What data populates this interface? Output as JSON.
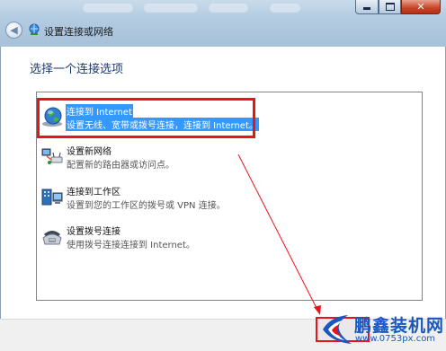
{
  "window": {
    "title": "设置连接或网络",
    "back_icon": "back-arrow-icon",
    "controls": {
      "minimize_icon": "minimize-icon",
      "maximize_icon": "maximize-icon",
      "close_icon": "close-icon",
      "close_glyph": "✕"
    }
  },
  "main": {
    "heading": "选择一个连接选项",
    "options": [
      {
        "title": "连接到 Internet",
        "desc": "设置无线、宽带或拨号连接，连接到 Internet。",
        "icon": "globe-network-icon",
        "selected": true
      },
      {
        "title": "设置新网络",
        "desc": "配置新的路由器或访问点。",
        "icon": "new-network-icon",
        "selected": false
      },
      {
        "title": "连接到工作区",
        "desc": "设置到您的工作区的拨号或 VPN 连接。",
        "icon": "workplace-icon",
        "selected": false
      },
      {
        "title": "设置拨号连接",
        "desc": "使用拨号连接连接到 Internet。",
        "icon": "dialup-icon",
        "selected": false
      }
    ]
  },
  "footer": {
    "next_button_label": ""
  },
  "annotation": {
    "color": "#e8141b"
  },
  "watermark": {
    "name": "鹏鑫装机网",
    "url": "www.0753px.com"
  },
  "colors": {
    "selection": "#3399ff",
    "heading": "#1f3a6e"
  }
}
